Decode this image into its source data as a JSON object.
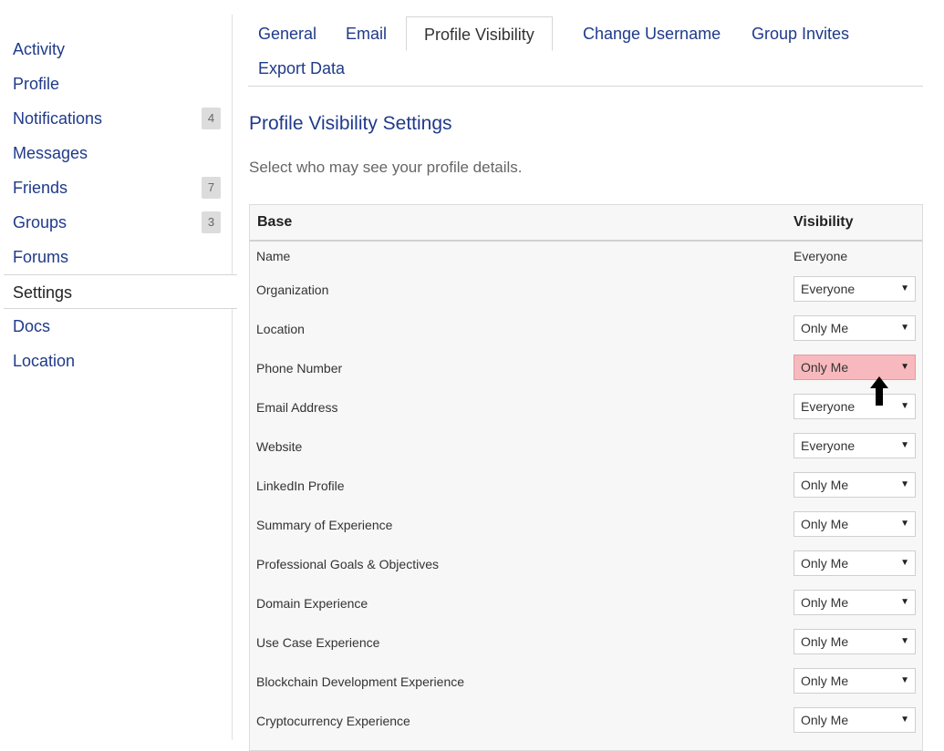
{
  "sidebar": {
    "items": [
      {
        "label": "Activity",
        "badge": ""
      },
      {
        "label": "Profile",
        "badge": ""
      },
      {
        "label": "Notifications",
        "badge": "4"
      },
      {
        "label": "Messages",
        "badge": ""
      },
      {
        "label": "Friends",
        "badge": "7"
      },
      {
        "label": "Groups",
        "badge": "3"
      },
      {
        "label": "Forums",
        "badge": ""
      },
      {
        "label": "Settings",
        "badge": ""
      },
      {
        "label": "Docs",
        "badge": ""
      },
      {
        "label": "Location",
        "badge": ""
      }
    ],
    "active": "Settings"
  },
  "tabs": [
    {
      "label": "General"
    },
    {
      "label": "Email"
    },
    {
      "label": "Profile Visibility"
    },
    {
      "label": "Change Username"
    },
    {
      "label": "Group Invites"
    },
    {
      "label": "Export Data"
    }
  ],
  "page": {
    "title": "Profile Visibility Settings",
    "description": "Select who may see your profile details."
  },
  "table": {
    "header_base": "Base",
    "header_visibility": "Visibility",
    "rows": [
      {
        "label": "Name",
        "value": "Everyone"
      },
      {
        "label": "Organization",
        "value": "Everyone"
      },
      {
        "label": "Location",
        "value": "Only Me"
      },
      {
        "label": "Phone Number",
        "value": "Only Me"
      },
      {
        "label": "Email Address",
        "value": "Everyone"
      },
      {
        "label": "Website",
        "value": "Everyone"
      },
      {
        "label": "LinkedIn Profile",
        "value": "Only Me"
      },
      {
        "label": "Summary of Experience",
        "value": "Only Me"
      },
      {
        "label": "Professional Goals & Objectives",
        "value": "Only Me"
      },
      {
        "label": "Domain Experience",
        "value": "Only Me"
      },
      {
        "label": "Use Case Experience",
        "value": "Only Me"
      },
      {
        "label": "Blockchain Development Experience",
        "value": "Only Me"
      },
      {
        "label": "Cryptocurrency Experience",
        "value": "Only Me"
      }
    ]
  },
  "colors": {
    "link": "#1f3a8a",
    "highlight_select": "#f7b9bd"
  },
  "icons": {
    "dropdown": "caret-down-icon",
    "pointer": "up-arrow-icon"
  }
}
